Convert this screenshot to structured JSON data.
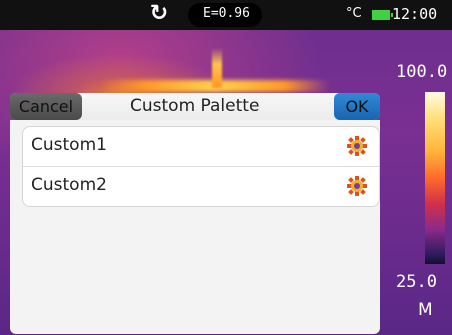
{
  "status_bar": {
    "refresh_icon": "refresh-icon",
    "emissivity": "E=0.96",
    "unit": "°C",
    "battery_icon": "battery-icon",
    "time": "12:00"
  },
  "scale": {
    "max": "100.0",
    "min": "25.0",
    "mode": "M"
  },
  "dialog": {
    "cancel_label": "Cancel",
    "title": "Custom Palette",
    "ok_label": "OK",
    "items": [
      {
        "label": "Custom1",
        "icon": "gear-icon"
      },
      {
        "label": "Custom2",
        "icon": "gear-icon"
      }
    ]
  },
  "colors": {
    "ok_button": "#1f74c4",
    "cancel_button": "#555555",
    "battery": "#3fd13f"
  }
}
